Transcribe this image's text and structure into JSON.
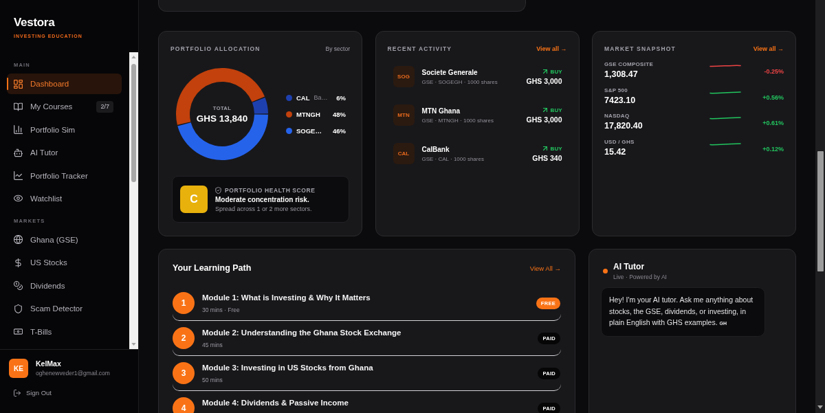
{
  "sidebar": {
    "brand": "Vestora",
    "tagline": "INVESTING EDUCATION",
    "sections": [
      {
        "heading": "MAIN",
        "items": [
          {
            "label": "Dashboard",
            "selected": true
          },
          {
            "label": "My Courses",
            "selected": false,
            "badge": "2/7"
          },
          {
            "label": "Portfolio Sim",
            "selected": false
          },
          {
            "label": "AI Tutor",
            "selected": false
          },
          {
            "label": "Portfolio Tracker",
            "selected": false
          },
          {
            "label": "Watchlist",
            "selected": false
          }
        ]
      },
      {
        "heading": "MARKETS",
        "items": [
          {
            "label": "Ghana (GSE)",
            "selected": false
          },
          {
            "label": "US Stocks",
            "selected": false
          },
          {
            "label": "Dividends",
            "selected": false
          },
          {
            "label": "Scam Detector",
            "selected": false
          },
          {
            "label": "T-Bills",
            "selected": false
          }
        ]
      }
    ],
    "user": {
      "initials": "KE",
      "name": "KelMax",
      "email": "oghenewveder1@gmail.com"
    },
    "sign_out": "Sign Out"
  },
  "allocation": {
    "title": "PORTFOLIO ALLOCATION",
    "filter": "By sector",
    "total_label": "TOTAL",
    "total_value": "GHS 13,840",
    "legend": [
      {
        "sector": "Ba…",
        "percent": "6%",
        "color": "#1e40af"
      },
      {
        "percent": "48%",
        "color": "#c2410c"
      },
      {
        "percent": "46%",
        "color": "#2563eb"
      }
    ],
    "chart_data": {
      "type": "donut",
      "categories": [
        "CAL",
        "MTNGH",
        "SOGE…"
      ],
      "series": [
        {
          "values": [
            6,
            48,
            46
          ]
        }
      ]
    },
    "health": {
      "grade": "C",
      "title": "PORTFOLIO HEALTH SCORE",
      "headline": "Moderate concentration risk.",
      "detail": "Spread across 1 or 2 more sectors."
    }
  },
  "activity": {
    "title": "RECENT ACTIVITY",
    "link": "View all →",
    "items": [
      {
        "code": "SOG",
        "name": "Societe Generale",
        "details": "GSE · SOGEGH · 1000 shares",
        "side": "BUY",
        "amount": "GHS 3,000"
      },
      {
        "code": "MTN",
        "name": "MTN Ghana",
        "details": "GSE · MTNGH · 1000 shares",
        "side": "BUY",
        "amount": "GHS 3,000"
      },
      {
        "code": "CAL",
        "name": "CalBank",
        "details": "GSE · CAL · 1000 shares",
        "side": "BUY",
        "amount": "GHS 340"
      }
    ]
  },
  "market": {
    "title": "MARKET SNAPSHOT",
    "link": "View all →",
    "items": [
      {
        "name": "GSE COMPOSITE",
        "value": "1,308.47",
        "change": "-0.25%",
        "kind": "down"
      },
      {
        "name": "S&P 500",
        "value": "7423.10",
        "change": "+0.56%",
        "kind": "up"
      },
      {
        "name": "NASDAQ",
        "value": "17,820.40",
        "change": "+0.61%",
        "kind": "up"
      },
      {
        "name": "USD / GHS",
        "value": "15.42",
        "change": "+0.12%",
        "kind": "up"
      }
    ]
  },
  "learning": {
    "title": "Your Learning Path",
    "link": "View All →",
    "modules": [
      {
        "number": "1",
        "title": "Module 1: What is Investing & Why It Matters",
        "meta": "30 mins · Free",
        "tag": "FREE",
        "kind": "free"
      },
      {
        "number": "2",
        "title": "Module 2: Understanding the Ghana Stock Exchange",
        "meta": "45 mins",
        "tag": "PAID",
        "kind": "paid"
      },
      {
        "number": "3",
        "title": "Module 3: Investing in US Stocks from Ghana",
        "meta": "50 mins",
        "tag": "PAID",
        "kind": "paid"
      },
      {
        "number": "4",
        "title": "Module 4: Dividends & Passive Income",
        "tag": "PAID",
        "kind": "paid"
      }
    ]
  },
  "tutor": {
    "title": "AI Tutor",
    "status": "Live · Powered by AI",
    "live": true,
    "message": "Hey! I'm your AI tutor. Ask me anything about stocks, the GSE, dividends, or investing, in plain English with GHS examples.",
    "flag": "GH"
  }
}
